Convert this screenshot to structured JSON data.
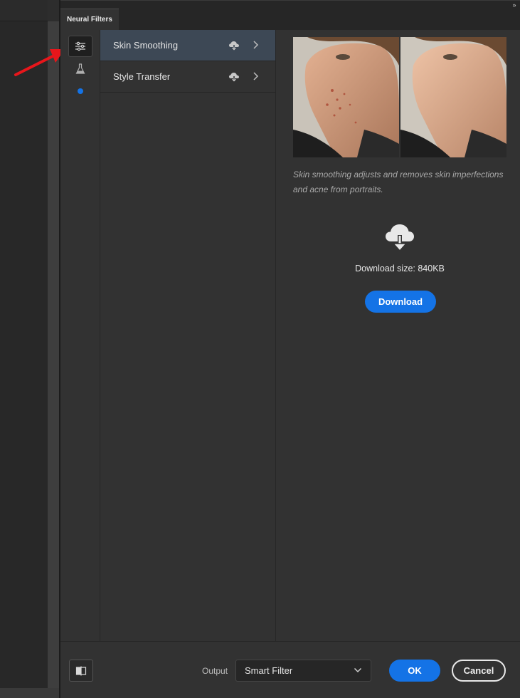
{
  "panel": {
    "tab_title": "Neural Filters",
    "collapse_glyph": "»"
  },
  "icon_rail": [
    {
      "name": "all-filters-icon",
      "active": true
    },
    {
      "name": "beta-filters-flask-icon",
      "active": false
    }
  ],
  "filters": [
    {
      "label": "Skin Smoothing",
      "selected": true,
      "icon": "cloud-download-icon"
    },
    {
      "label": "Style Transfer",
      "selected": false,
      "icon": "cloud-download-icon"
    }
  ],
  "detail": {
    "preview_alt": "before-after-portrait",
    "description": "Skin smoothing adjusts and removes skin imperfections and acne from portraits.",
    "download_size": "Download size: 840KB",
    "download_label": "Download"
  },
  "footer": {
    "output_label": "Output",
    "output_value": "Smart Filter",
    "ok_label": "OK",
    "cancel_label": "Cancel"
  },
  "colors": {
    "accent": "#1473e6",
    "selected_row": "#3d4855",
    "annotation_arrow": "#e8161b"
  }
}
